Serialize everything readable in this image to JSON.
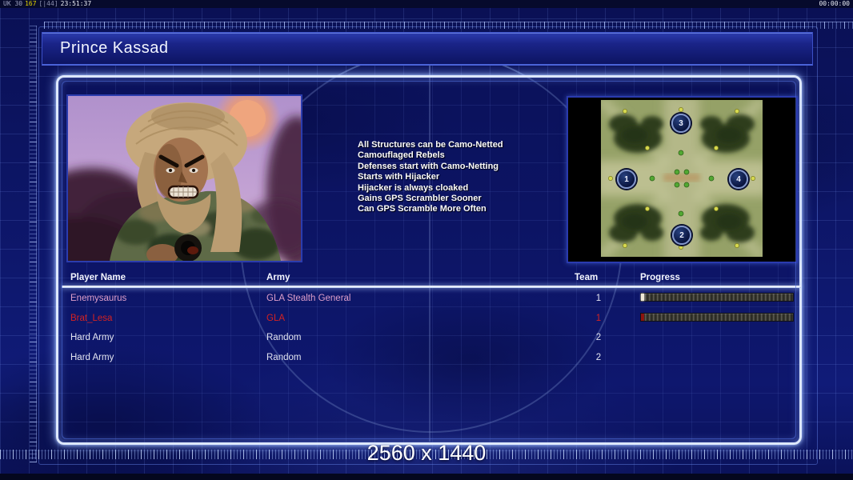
{
  "overlay": {
    "debug_left": {
      "app_tag": "UK 30",
      "fps_value": "167",
      "flags": "[|44]",
      "clock": "23:51:37"
    },
    "timer_right": "00:00:00"
  },
  "header": {
    "title": "Prince Kassad"
  },
  "general_info": {
    "abilities": [
      "All Structures can be Camo-Netted",
      "Camouflaged Rebels",
      "Defenses start with Camo-Netting",
      "Starts with Hijacker",
      "Hijacker is always cloaked",
      "Gains GPS Scrambler Sooner",
      "Can GPS Scramble More Often"
    ]
  },
  "map_preview": {
    "start_positions": [
      "1",
      "2",
      "3",
      "4"
    ]
  },
  "player_table": {
    "columns": {
      "name": "Player Name",
      "army": "Army",
      "team": "Team",
      "progress": "Progress"
    },
    "rows": [
      {
        "name": "Enemysaurus",
        "army": "GLA Stealth General",
        "team": "1",
        "progress_percent": 2
      },
      {
        "name": "Brat_Lesa",
        "army": "GLA",
        "team": "1",
        "progress_percent": 2
      },
      {
        "name": "Hard Army",
        "army": "Random",
        "team": "2"
      },
      {
        "name": "Hard Army",
        "army": "Random",
        "team": "2"
      }
    ]
  },
  "footer": {
    "resolution": "2560 x 1440"
  },
  "colors": {
    "background_blue": "#0d1668",
    "grid_line": "#8296ff",
    "panel_glow": "#dde8ff",
    "title_text": "#f2f5ff",
    "player_pink": "#de9fca",
    "player_red": "#d42222",
    "player_white": "#e2e4f0",
    "progress_track_light": "#54534a",
    "progress_track_dark": "#21211c",
    "progress_lead_white": "#efe9d8",
    "progress_lead_red": "#8c1410",
    "map_terrain_green": "#95a167",
    "map_forest_dark": "#2e3d1d",
    "marker_fill": "#0a1540",
    "debug_yellow": "#e4d400"
  }
}
